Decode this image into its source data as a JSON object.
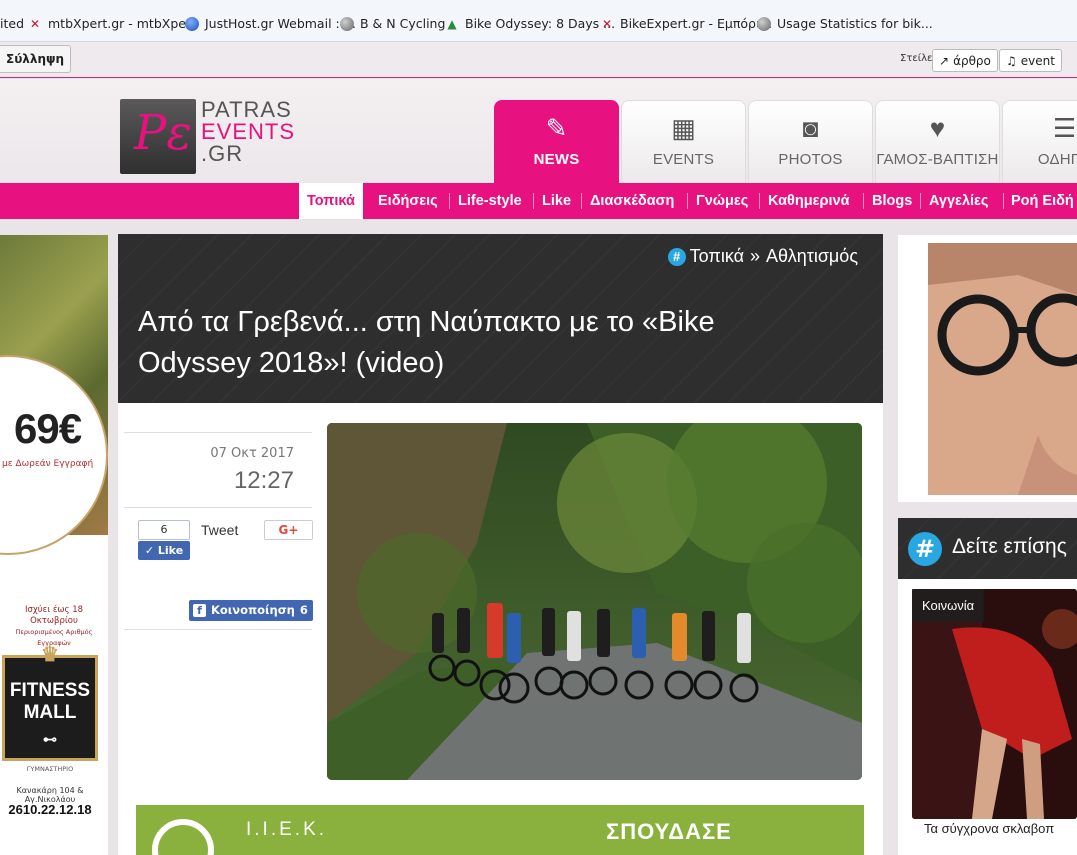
{
  "bookmarks": [
    {
      "label": "ited",
      "icon": "none"
    },
    {
      "label": "mtbXpert.gr - mtbXpe...",
      "icon": "x-favicon-icon"
    },
    {
      "label": "JustHost.gr Webmail ::...",
      "icon": "justhost-favicon-icon"
    },
    {
      "label": "B & N Cycling",
      "icon": "globe-icon"
    },
    {
      "label": "Bike Odyssey: 8 Days ...",
      "icon": "mountain-favicon-icon"
    },
    {
      "label": "BikeExpert.gr - Εμπόρι...",
      "icon": "x-favicon-icon"
    },
    {
      "label": "Usage Statistics for bik...",
      "icon": "globe-icon"
    }
  ],
  "topstrip": {
    "collection_label": "Σύλληψη",
    "send_label": "Στείλε",
    "article_btn": "άρθρο",
    "event_btn": "event"
  },
  "logo": {
    "line1": "PATRAS",
    "line2": "EVENTS",
    "line3": ".GR",
    "mark": "Pε"
  },
  "nav_tabs": [
    {
      "label": "NEWS",
      "icon": "pencil-icon",
      "active": true
    },
    {
      "label": "EVENTS",
      "icon": "calendar-icon",
      "active": false
    },
    {
      "label": "PHOTOS",
      "icon": "camera-icon",
      "active": false
    },
    {
      "label": "ΓΑΜΟΣ-ΒΑΠΤΙΣΗ",
      "icon": "heart-icon",
      "active": false
    },
    {
      "label": "ΟΔΗΓΟ",
      "icon": "list-icon",
      "active": false
    }
  ],
  "categories": [
    "Τοπικά",
    "Ειδήσεις",
    "Life-style",
    "Like",
    "Διασκέδαση",
    "Γνώμες",
    "Καθημερινά",
    "Blogs",
    "Αγγελίες",
    "Ροή Ειδή"
  ],
  "active_category": "Τοπικά",
  "article": {
    "crumb_section": "Τοπικά",
    "crumb_sep": "»",
    "crumb_sub": "Αθλητισμός",
    "title": "Από τα Γρεβενά... στη Ναύπακτο με το «Bike Odyssey 2018»! (video)",
    "date": "07 Οκτ 2017",
    "time": "12:27",
    "fb_like_count": "6",
    "fb_like_label": "Like",
    "tweet_label": "Tweet",
    "gplus_label": "G+",
    "share_label": "Κοινοποίηση",
    "share_count": "6"
  },
  "left_ad": {
    "price": "69€",
    "price_sub": "με Δωρεάν Εγγραφή",
    "promo": "Ισχύει έως 18 Οκτωβρίου",
    "promo2": "Περιορισμένος Αριθμός Εγγραφών",
    "brand_line1": "FITNESS",
    "brand_line2": "MALL",
    "gym": "ΓΥΜΝΑΣΤΗΡΙΟ",
    "address": "Κανακάρη 104 & Αγ.Νικολάου",
    "phone": "2610.22.12.18"
  },
  "bottom_ad": {
    "brand": "Ι.Ι.Ε.Κ.",
    "cta": "ΣΠΟΥΔΑΣΕ"
  },
  "right": {
    "see_also": "Δείτε επίσης",
    "card_tag": "Κοινωνία",
    "card_caption": "Τα σύγχρονα σκλαβοπ"
  },
  "colors": {
    "brand_pink": "#e7117f",
    "accent_blue": "#29a7e1",
    "dark": "#2e2e2e",
    "facebook": "#4267b2"
  }
}
